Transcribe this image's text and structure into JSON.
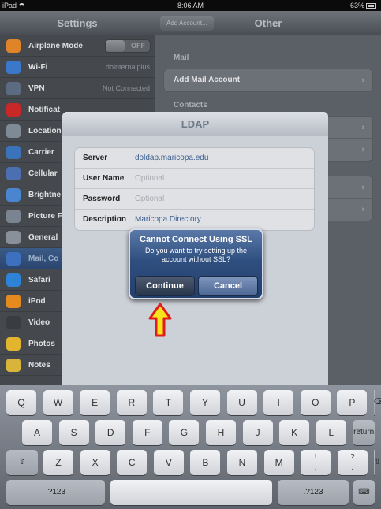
{
  "status": {
    "device": "iPad",
    "time": "8:06 AM",
    "battery": "63%"
  },
  "settings": {
    "title": "Settings",
    "items": [
      {
        "label": "Airplane Mode",
        "toggle": "OFF",
        "color": "#e0842a"
      },
      {
        "label": "Wi-Fi",
        "value": "dointernalplus",
        "color": "#3b78c9"
      },
      {
        "label": "VPN",
        "value": "Not Connected",
        "color": "#5d6b82"
      },
      {
        "label": "Notificat",
        "color": "#c92828"
      },
      {
        "label": "Location",
        "color": "#7f8a97"
      },
      {
        "label": "Carrier",
        "color": "#3a73b9"
      },
      {
        "label": "Cellular",
        "color": "#4b6fb0"
      },
      {
        "label": "Brightne",
        "color": "#4a86cf"
      },
      {
        "label": "Picture F",
        "color": "#7a8390"
      },
      {
        "label": "General",
        "color": "#8a9099"
      },
      {
        "label": "Mail, Co",
        "color": "#3e70c0",
        "selected": true
      },
      {
        "label": "Safari",
        "color": "#2f83d6"
      },
      {
        "label": "iPod",
        "color": "#e48a1f"
      },
      {
        "label": "Video",
        "color": "#3a3c40"
      },
      {
        "label": "Photos",
        "color": "#e3b52e"
      },
      {
        "label": "Notes",
        "color": "#d9b43a"
      }
    ]
  },
  "detail": {
    "back_label": "Add Account...",
    "title": "Other",
    "mail_header": "Mail",
    "add_mail_account": "Add Mail Account",
    "contacts_header": "Contacts"
  },
  "ldap": {
    "title": "LDAP",
    "fields": [
      {
        "label": "Server",
        "value": "doldap.maricopa.edu",
        "placeholder": ""
      },
      {
        "label": "User Name",
        "value": "",
        "placeholder": "Optional"
      },
      {
        "label": "Password",
        "value": "",
        "placeholder": "Optional"
      },
      {
        "label": "Description",
        "value": "Maricopa Directory",
        "placeholder": ""
      }
    ]
  },
  "alert": {
    "title": "Cannot Connect Using SSL",
    "message": "Do you want to try setting up the account without SSL?",
    "continue_label": "Continue",
    "cancel_label": "Cancel"
  },
  "keyboard": {
    "row1": [
      "Q",
      "W",
      "E",
      "R",
      "T",
      "Y",
      "U",
      "I",
      "O",
      "P"
    ],
    "row2": [
      "A",
      "S",
      "D",
      "F",
      "G",
      "H",
      "J",
      "K",
      "L"
    ],
    "return_label": "return",
    "row3": [
      "Z",
      "X",
      "C",
      "V",
      "B",
      "N",
      "M",
      "!\n,",
      "?\n."
    ],
    "mode_label": ".?123"
  }
}
